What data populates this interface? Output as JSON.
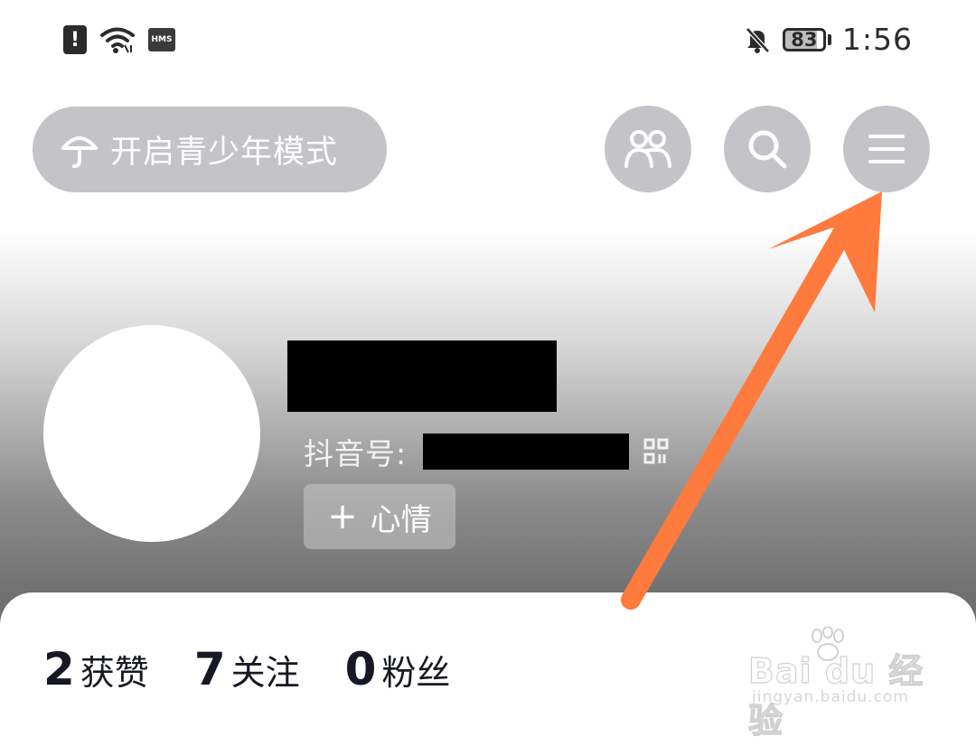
{
  "status_bar": {
    "alert_icon": "alert-icon",
    "wifi_icon": "wifi-icon",
    "hms_badge": "HMS",
    "mute_icon": "bell-off-icon",
    "battery_level": "83",
    "time": "1:56"
  },
  "header": {
    "teen_mode_label": "开启青少年模式",
    "teen_mode_icon": "umbrella-icon",
    "friends_icon": "friends-icon",
    "search_icon": "search-icon",
    "menu_icon": "menu-icon"
  },
  "profile": {
    "id_label": "抖音号:",
    "qr_icon": "qr-code-icon",
    "mood_plus": "+",
    "mood_label": "心情"
  },
  "stats": [
    {
      "num": "2",
      "label": "获赞"
    },
    {
      "num": "7",
      "label": "关注"
    },
    {
      "num": "0",
      "label": "粉丝"
    }
  ],
  "watermark": {
    "main": "Bai du 经验",
    "sub": "jingyan.baidu.com"
  },
  "annotation": {
    "arrow_color": "#ff7a3d",
    "background_top": "#ffffff",
    "background_bottom": "#707070",
    "button_color": "#c4c4c8"
  }
}
